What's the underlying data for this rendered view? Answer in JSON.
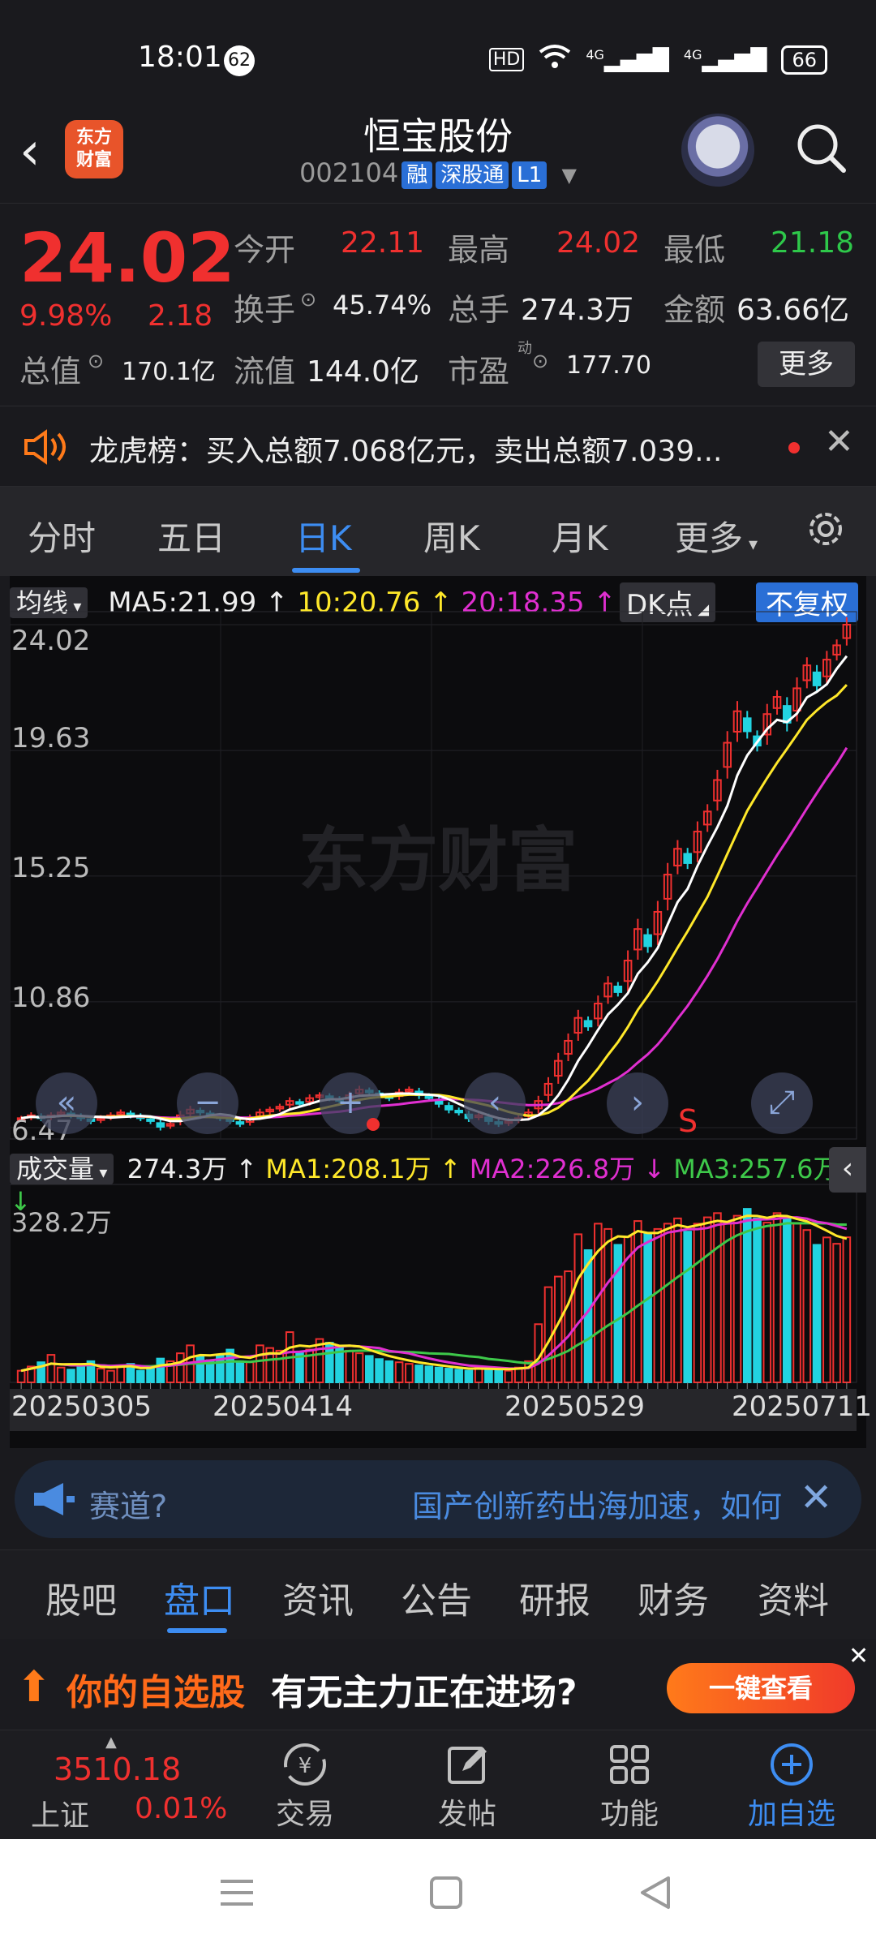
{
  "status": {
    "time": "18:01",
    "notif_count": "62",
    "net1": "4G",
    "net2": "4G",
    "battery": "66"
  },
  "header": {
    "logo_text": "东方财富",
    "title": "恒宝股份",
    "code": "002104",
    "tags": [
      "融",
      "深股通",
      "L1"
    ]
  },
  "quote": {
    "price": "24.02",
    "pct": "9.98%",
    "change": "2.18",
    "open_label": "今开",
    "open": "22.11",
    "high_label": "最高",
    "high": "24.02",
    "low_label": "最低",
    "low": "21.18",
    "turnover_label": "换手",
    "turnover": "45.74%",
    "volume_label": "总手",
    "volume": "274.3万",
    "amount_label": "金额",
    "amount": "63.66亿",
    "mktcap_label": "总值",
    "mktcap": "170.1亿",
    "float_label": "流值",
    "float": "144.0亿",
    "pe_label": "市盈",
    "pe_sup": "动",
    "pe": "177.70",
    "more": "更多"
  },
  "ticker": {
    "text": "龙虎榜：买入总额7.068亿元，卖出总额7.039..."
  },
  "period_tabs": [
    "分时",
    "五日",
    "日K",
    "周K",
    "月K",
    "更多"
  ],
  "chart": {
    "ma_select": "均线",
    "ma5": "MA5:21.99",
    "ma10": "10:20.76",
    "ma20": "20:18.35",
    "dk": "DK点",
    "fq": "不复权",
    "price_ticks": [
      "24.02",
      "19.63",
      "15.25",
      "10.86",
      "6.47"
    ],
    "watermark": "东方财富",
    "marker_s": "S",
    "vol_select": "成交量",
    "vol_now": "274.3万",
    "vol_ma1": "MA1:208.1万",
    "vol_ma2": "MA2:226.8万",
    "vol_ma3": "MA3:257.6万",
    "vol_max": "328.2万",
    "dates": [
      "20250305",
      "20250414",
      "20250529",
      "20250711"
    ],
    "colors": {
      "up": "#f0302f",
      "down": "#22d3e0",
      "ma5": "#ffffff",
      "ma10": "#ffe82a",
      "ma20": "#e02fd0",
      "vma3": "#3ec94a"
    }
  },
  "chart_data": {
    "type": "candlestick",
    "ylim": [
      6.47,
      24.02
    ],
    "y_ticks": [
      24.02,
      19.63,
      15.25,
      10.86,
      6.47
    ],
    "x_ticks": [
      "20250305",
      "20250414",
      "20250529",
      "20250711"
    ],
    "last_close": 24.02,
    "closes": [
      6.8,
      6.9,
      6.8,
      6.9,
      7.0,
      6.9,
      6.8,
      6.7,
      6.8,
      6.9,
      7.0,
      6.9,
      6.8,
      6.7,
      6.5,
      6.6,
      6.9,
      7.1,
      7.0,
      6.9,
      6.8,
      6.7,
      6.6,
      6.8,
      7.0,
      7.1,
      7.2,
      7.4,
      7.3,
      7.5,
      7.6,
      7.5,
      7.4,
      7.6,
      7.8,
      7.7,
      7.6,
      7.5,
      7.7,
      7.8,
      7.6,
      7.5,
      7.3,
      7.1,
      7.0,
      6.8,
      6.9,
      6.7,
      6.6,
      6.7,
      6.8,
      7.0,
      7.4,
      8.0,
      8.8,
      9.5,
      10.3,
      10.0,
      10.8,
      11.5,
      11.2,
      12.3,
      13.4,
      12.8,
      14.0,
      15.3,
      16.2,
      15.7,
      16.8,
      17.5,
      18.6,
      19.9,
      21.0,
      20.3,
      19.8,
      20.9,
      21.5,
      20.6,
      21.8,
      22.6,
      21.9,
      22.8,
      23.3,
      24.02
    ],
    "volumes_wan": [
      22,
      30,
      38,
      52,
      28,
      24,
      30,
      40,
      26,
      22,
      30,
      35,
      22,
      28,
      45,
      40,
      55,
      70,
      48,
      42,
      50,
      62,
      40,
      38,
      70,
      65,
      60,
      95,
      58,
      62,
      82,
      75,
      68,
      60,
      55,
      50,
      44,
      40,
      38,
      35,
      32,
      30,
      28,
      26,
      24,
      22,
      30,
      26,
      24,
      22,
      28,
      40,
      110,
      180,
      200,
      210,
      280,
      250,
      300,
      290,
      260,
      275,
      305,
      282,
      290,
      300,
      310,
      285,
      300,
      312,
      320,
      300,
      315,
      328,
      310,
      302,
      320,
      312,
      300,
      288,
      260,
      274,
      262,
      274.3
    ],
    "ma_legend": [
      {
        "name": "MA5",
        "value": 21.99
      },
      {
        "name": "MA10",
        "value": 20.76
      },
      {
        "name": "MA20",
        "value": 18.35
      }
    ],
    "volume_ma_legend": [
      {
        "name": "MA1",
        "value": "208.1万"
      },
      {
        "name": "MA2",
        "value": "226.8万"
      },
      {
        "name": "MA3",
        "value": "257.6万"
      }
    ]
  },
  "topic": {
    "label": "赛道?",
    "desc": "国产创新药出海加速，如何"
  },
  "sub_tabs": [
    "股吧",
    "盘口",
    "资讯",
    "公告",
    "研报",
    "财务",
    "资料"
  ],
  "ad": {
    "t1": "你的自选股",
    "t2": "有无主力正在进场?",
    "btn": "一键查看"
  },
  "bottom_nav": {
    "index_value": "3510.18",
    "index_name": "上证",
    "index_pct": "0.01%",
    "items": [
      {
        "label": "交易",
        "icon": "yuan-exchange-icon"
      },
      {
        "label": "发帖",
        "icon": "edit-icon"
      },
      {
        "label": "功能",
        "icon": "grid-icon"
      },
      {
        "label": "加自选",
        "icon": "plus-circle-icon"
      }
    ]
  }
}
